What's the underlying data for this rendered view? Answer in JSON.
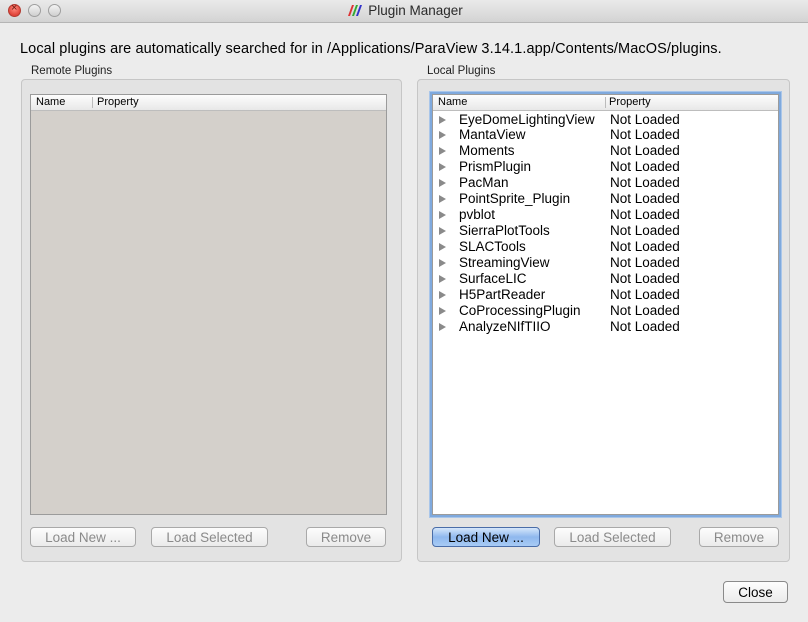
{
  "window": {
    "title": "Plugin Manager"
  },
  "info_text": "Local plugins are automatically searched for in /Applications/ParaView 3.14.1.app/Contents/MacOS/plugins.",
  "remote": {
    "label": "Remote Plugins",
    "columns": [
      "Name",
      "Property"
    ],
    "buttons": {
      "load_new": "Load New ...",
      "load_selected": "Load Selected",
      "remove": "Remove"
    }
  },
  "local": {
    "label": "Local Plugins",
    "columns": [
      "Name",
      "Property"
    ],
    "plugins": [
      {
        "name": "EyeDomeLightingView",
        "status": "Not Loaded"
      },
      {
        "name": "MantaView",
        "status": "Not Loaded"
      },
      {
        "name": "Moments",
        "status": "Not Loaded"
      },
      {
        "name": "PrismPlugin",
        "status": "Not Loaded"
      },
      {
        "name": "PacMan",
        "status": "Not Loaded"
      },
      {
        "name": "PointSprite_Plugin",
        "status": "Not Loaded"
      },
      {
        "name": "pvblot",
        "status": "Not Loaded"
      },
      {
        "name": "SierraPlotTools",
        "status": "Not Loaded"
      },
      {
        "name": "SLACTools",
        "status": "Not Loaded"
      },
      {
        "name": "StreamingView",
        "status": "Not Loaded"
      },
      {
        "name": "SurfaceLIC",
        "status": "Not Loaded"
      },
      {
        "name": "H5PartReader",
        "status": "Not Loaded"
      },
      {
        "name": "CoProcessingPlugin",
        "status": "Not Loaded"
      },
      {
        "name": "AnalyzeNIfTIIO",
        "status": "Not Loaded"
      }
    ],
    "buttons": {
      "load_new": "Load New ...",
      "load_selected": "Load Selected",
      "remove": "Remove"
    }
  },
  "close_label": "Close"
}
